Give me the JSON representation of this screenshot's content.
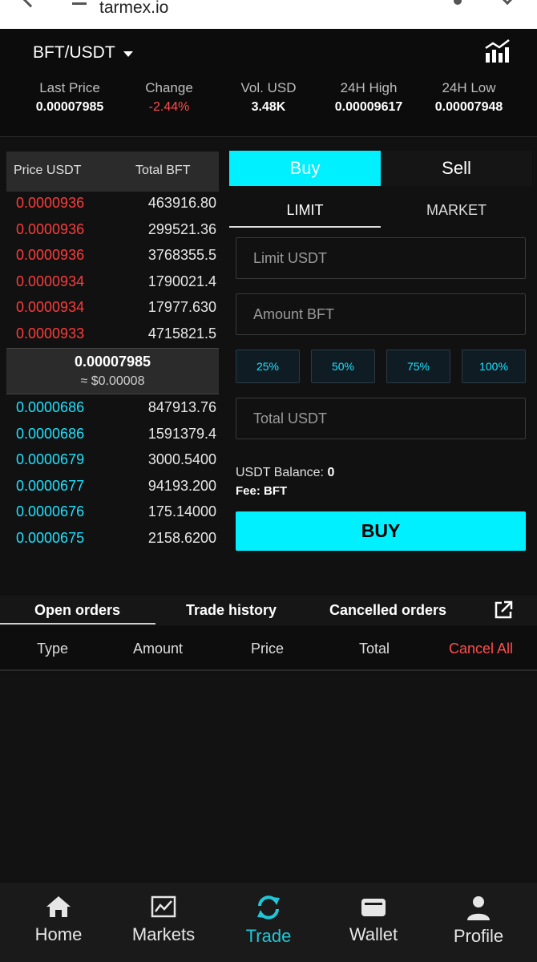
{
  "browser": {
    "url": "tarmex.io"
  },
  "header": {
    "pair": "BFT/USDT",
    "stats": [
      {
        "label": "Last Price",
        "value": "0.00007985"
      },
      {
        "label": "Change",
        "value": "-2.44%"
      },
      {
        "label": "Vol. USD",
        "value": "3.48K"
      },
      {
        "label": "24H High",
        "value": "0.00009617"
      },
      {
        "label": "24H Low",
        "value": "0.00007948"
      }
    ]
  },
  "orderbook": {
    "col_price": "Price USDT",
    "col_total": "Total BFT",
    "asks": [
      {
        "price": "0.0000936",
        "total": "463916.80"
      },
      {
        "price": "0.0000936",
        "total": "299521.36"
      },
      {
        "price": "0.0000936",
        "total": "3768355.5"
      },
      {
        "price": "0.0000934",
        "total": "1790021.4"
      },
      {
        "price": "0.0000934",
        "total": "17977.630"
      },
      {
        "price": "0.0000933",
        "total": "4715821.5"
      }
    ],
    "last_price": "0.00007985",
    "last_price_usd": "≈ $0.00008",
    "bids": [
      {
        "price": "0.0000686",
        "total": "847913.76"
      },
      {
        "price": "0.0000686",
        "total": "1591379.4"
      },
      {
        "price": "0.0000679",
        "total": "3000.5400"
      },
      {
        "price": "0.0000677",
        "total": "94193.200"
      },
      {
        "price": "0.0000676",
        "total": "175.14000"
      },
      {
        "price": "0.0000675",
        "total": "2158.6200"
      }
    ]
  },
  "trade": {
    "buy_tab": "Buy",
    "sell_tab": "Sell",
    "limit_tab": "LIMIT",
    "market_tab": "MARKET",
    "limit_placeholder": "Limit USDT",
    "amount_placeholder": "Amount BFT",
    "total_placeholder": "Total USDT",
    "pct": [
      "25%",
      "50%",
      "75%",
      "100%"
    ],
    "balance_label": "USDT Balance:",
    "balance_value": "0",
    "fee": "Fee: BFT",
    "buy_button": "BUY"
  },
  "orders": {
    "tabs": [
      "Open orders",
      "Trade history",
      "Cancelled orders"
    ],
    "columns": [
      "Type",
      "Amount",
      "Price",
      "Total"
    ],
    "cancel_all": "Cancel All"
  },
  "nav": {
    "items": [
      "Home",
      "Markets",
      "Trade",
      "Wallet",
      "Profile"
    ],
    "active": "Trade"
  },
  "colors": {
    "accent": "#00f0ff",
    "ask": "#ff3b3b",
    "bid": "#1fe2ff",
    "negative": "#ff4d4d"
  }
}
